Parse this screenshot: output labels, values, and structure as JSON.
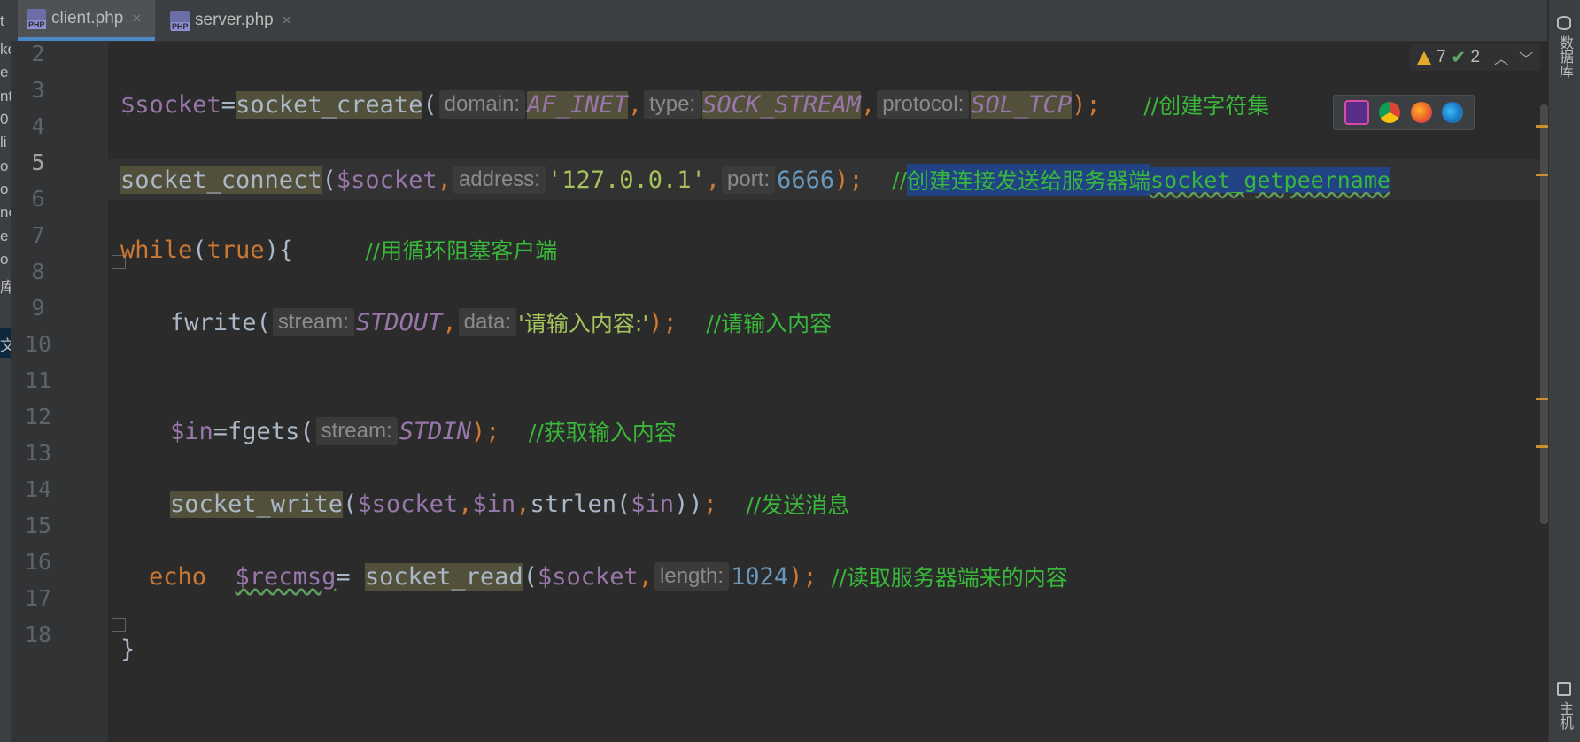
{
  "tabs": [
    {
      "label": "client.php",
      "active": true,
      "icon": "php-file-icon",
      "badge": "PHP"
    },
    {
      "label": "server.php",
      "active": false,
      "icon": "php-file-icon",
      "badge": "PHP"
    }
  ],
  "close_glyph": "×",
  "left_strip_fragments": [
    "t",
    "ke",
    "e",
    "nt",
    "0",
    "li",
    "o",
    "o",
    "ne",
    "e",
    "o",
    "库",
    "文"
  ],
  "line_numbers": [
    "2",
    "3",
    "4",
    "5",
    "6",
    "7",
    "8",
    "9",
    "10",
    "11",
    "12",
    "13",
    "14",
    "15",
    "16",
    "17",
    "18"
  ],
  "current_line": "5",
  "inspections": {
    "warnings": "7",
    "weak_warnings": "2"
  },
  "browsers": [
    "phpstorm-icon",
    "chrome-icon",
    "firefox-icon",
    "edge-icon"
  ],
  "right_strip": {
    "database": "数据库",
    "remote_host": "远程主机"
  },
  "code": {
    "l3": {
      "var": "$socket",
      "eq": "=",
      "fn": "socket_create",
      "open": "(",
      "h1": "domain:",
      "a1": "AF_INET",
      "comma1": ",",
      "h2": "type:",
      "a2": "SOCK_STREAM",
      "comma2": ",",
      "h3": "protocol:",
      "a3": "SOL_TCP",
      "close": ");",
      "comment": "//创建字符集"
    },
    "l5": {
      "fn": "socket_connect",
      "open": "(",
      "a1": "$socket",
      "comma1": ",",
      "h2": "address:",
      "a2": "'127.0.0.1'",
      "comma2": ",",
      "h3": "port:",
      "a3": "6666",
      "close": ");",
      "comment_prefix": "//",
      "comment_sel": "创建连接发送给服务器端",
      "comment_sel_code": "socket_getpeername"
    },
    "l7": {
      "kw": "while",
      "open": "(",
      "val": "true",
      "close": "){",
      "comment": "//用循环阻塞客户端"
    },
    "l9": {
      "fn": "fwrite",
      "open": "(",
      "h1": "stream:",
      "a1": "STDOUT",
      "comma1": ",",
      "h2": "data:",
      "a2": "'请输入内容:'",
      "close": ");",
      "comment": "//请输入内容"
    },
    "l12": {
      "var": "$in",
      "eq": "=",
      "fn": "fgets",
      "open": "(",
      "h1": "stream:",
      "a1": "STDIN",
      "close": ");",
      "comment": "//获取输入内容"
    },
    "l14": {
      "fn": "socket_write",
      "open": "(",
      "a1": "$socket",
      "comma1": ",",
      "a2": "$in",
      "comma2": ",",
      "fn2": "strlen",
      "open2": "(",
      "a3": "$in",
      "close2": "))",
      "semi": ";",
      "comment": "//发送消息"
    },
    "l16": {
      "kw": "echo",
      "var": "$recmsg",
      "eq": "=",
      "fn": "socket_read",
      "open": "(",
      "a1": "$socket",
      "comma1": ",",
      "h2": "length:",
      "a2": "1024",
      "close": ");",
      "comment": "//读取服务器端来的内容"
    },
    "l18": {
      "brace": "}"
    }
  }
}
